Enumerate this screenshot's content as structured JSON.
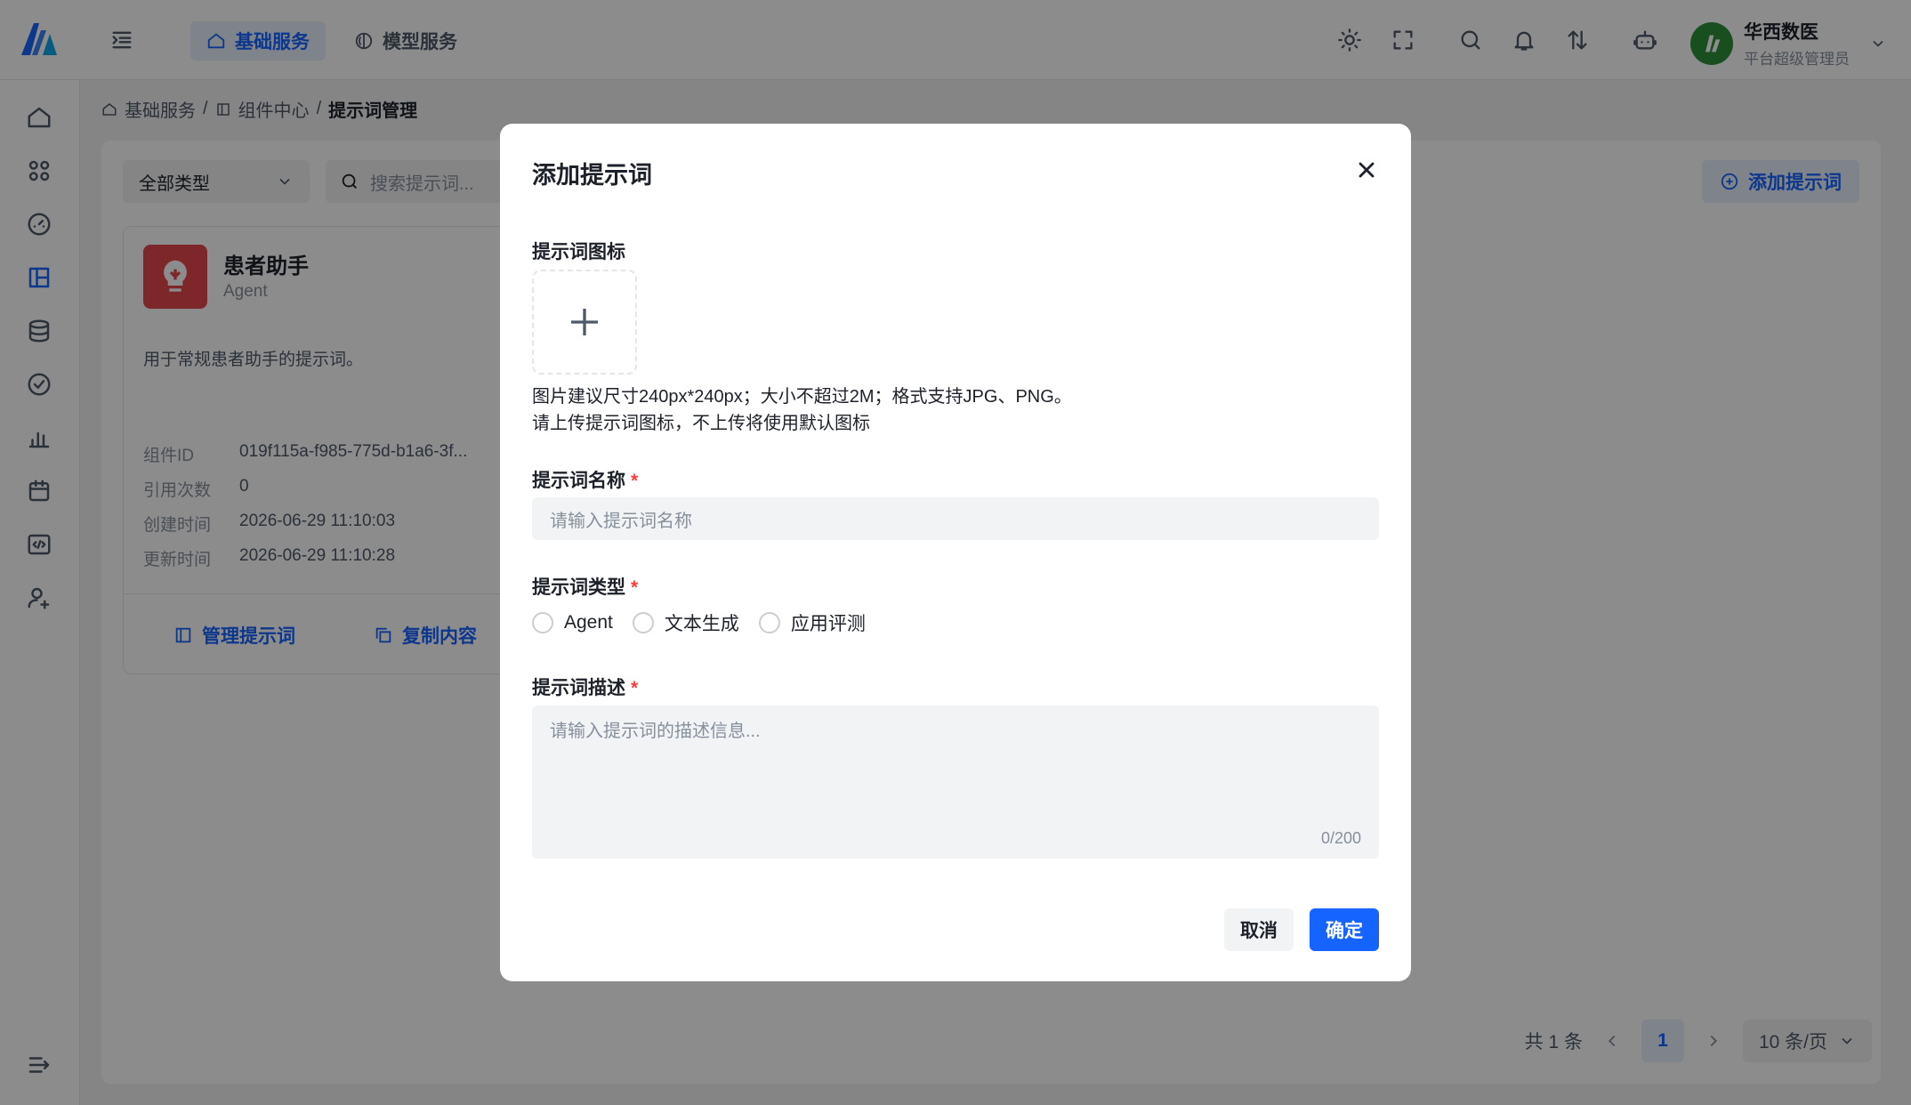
{
  "header": {
    "tabs": [
      {
        "label": "基础服务",
        "active": true
      },
      {
        "label": "模型服务",
        "active": false
      }
    ],
    "user": {
      "name": "华西数医",
      "role": "平台超级管理员"
    }
  },
  "breadcrumb": {
    "items": [
      "基础服务",
      "组件中心",
      "提示词管理"
    ],
    "separator": "/"
  },
  "toolbar": {
    "type_select": "全部类型",
    "search_placeholder": "搜索提示词...",
    "add_label": "添加提示词"
  },
  "card": {
    "title": "患者助手",
    "type": "Agent",
    "description": "用于常规患者助手的提示词。",
    "meta": [
      {
        "label": "组件ID",
        "value": "019f115a-f985-775d-b1a6-3f..."
      },
      {
        "label": "引用次数",
        "value": "0"
      },
      {
        "label": "创建时间",
        "value": "2026-06-29 11:10:03"
      },
      {
        "label": "更新时间",
        "value": "2026-06-29 11:10:28"
      }
    ],
    "actions": {
      "manage": "管理提示词",
      "copy": "复制内容"
    }
  },
  "pagination": {
    "total": "共 1 条",
    "page": "1",
    "page_size": "10 条/页"
  },
  "modal": {
    "title": "添加提示词",
    "icon_label": "提示词图标",
    "icon_hint_1": "图片建议尺寸240px*240px；大小不超过2M；格式支持JPG、PNG。",
    "icon_hint_2": "请上传提示词图标，不上传将使用默认图标",
    "name_label": "提示词名称",
    "name_placeholder": "请输入提示词名称",
    "type_label": "提示词类型",
    "type_options": [
      "Agent",
      "文本生成",
      "应用评测"
    ],
    "desc_label": "提示词描述",
    "desc_placeholder": "请输入提示词的描述信息...",
    "desc_counter": "0/200",
    "required_mark": "*",
    "cancel": "取消",
    "confirm": "确定"
  },
  "colors": {
    "primary": "#1664ff",
    "required": "#f53f3f",
    "card_icon_bg": "#e5484d"
  }
}
